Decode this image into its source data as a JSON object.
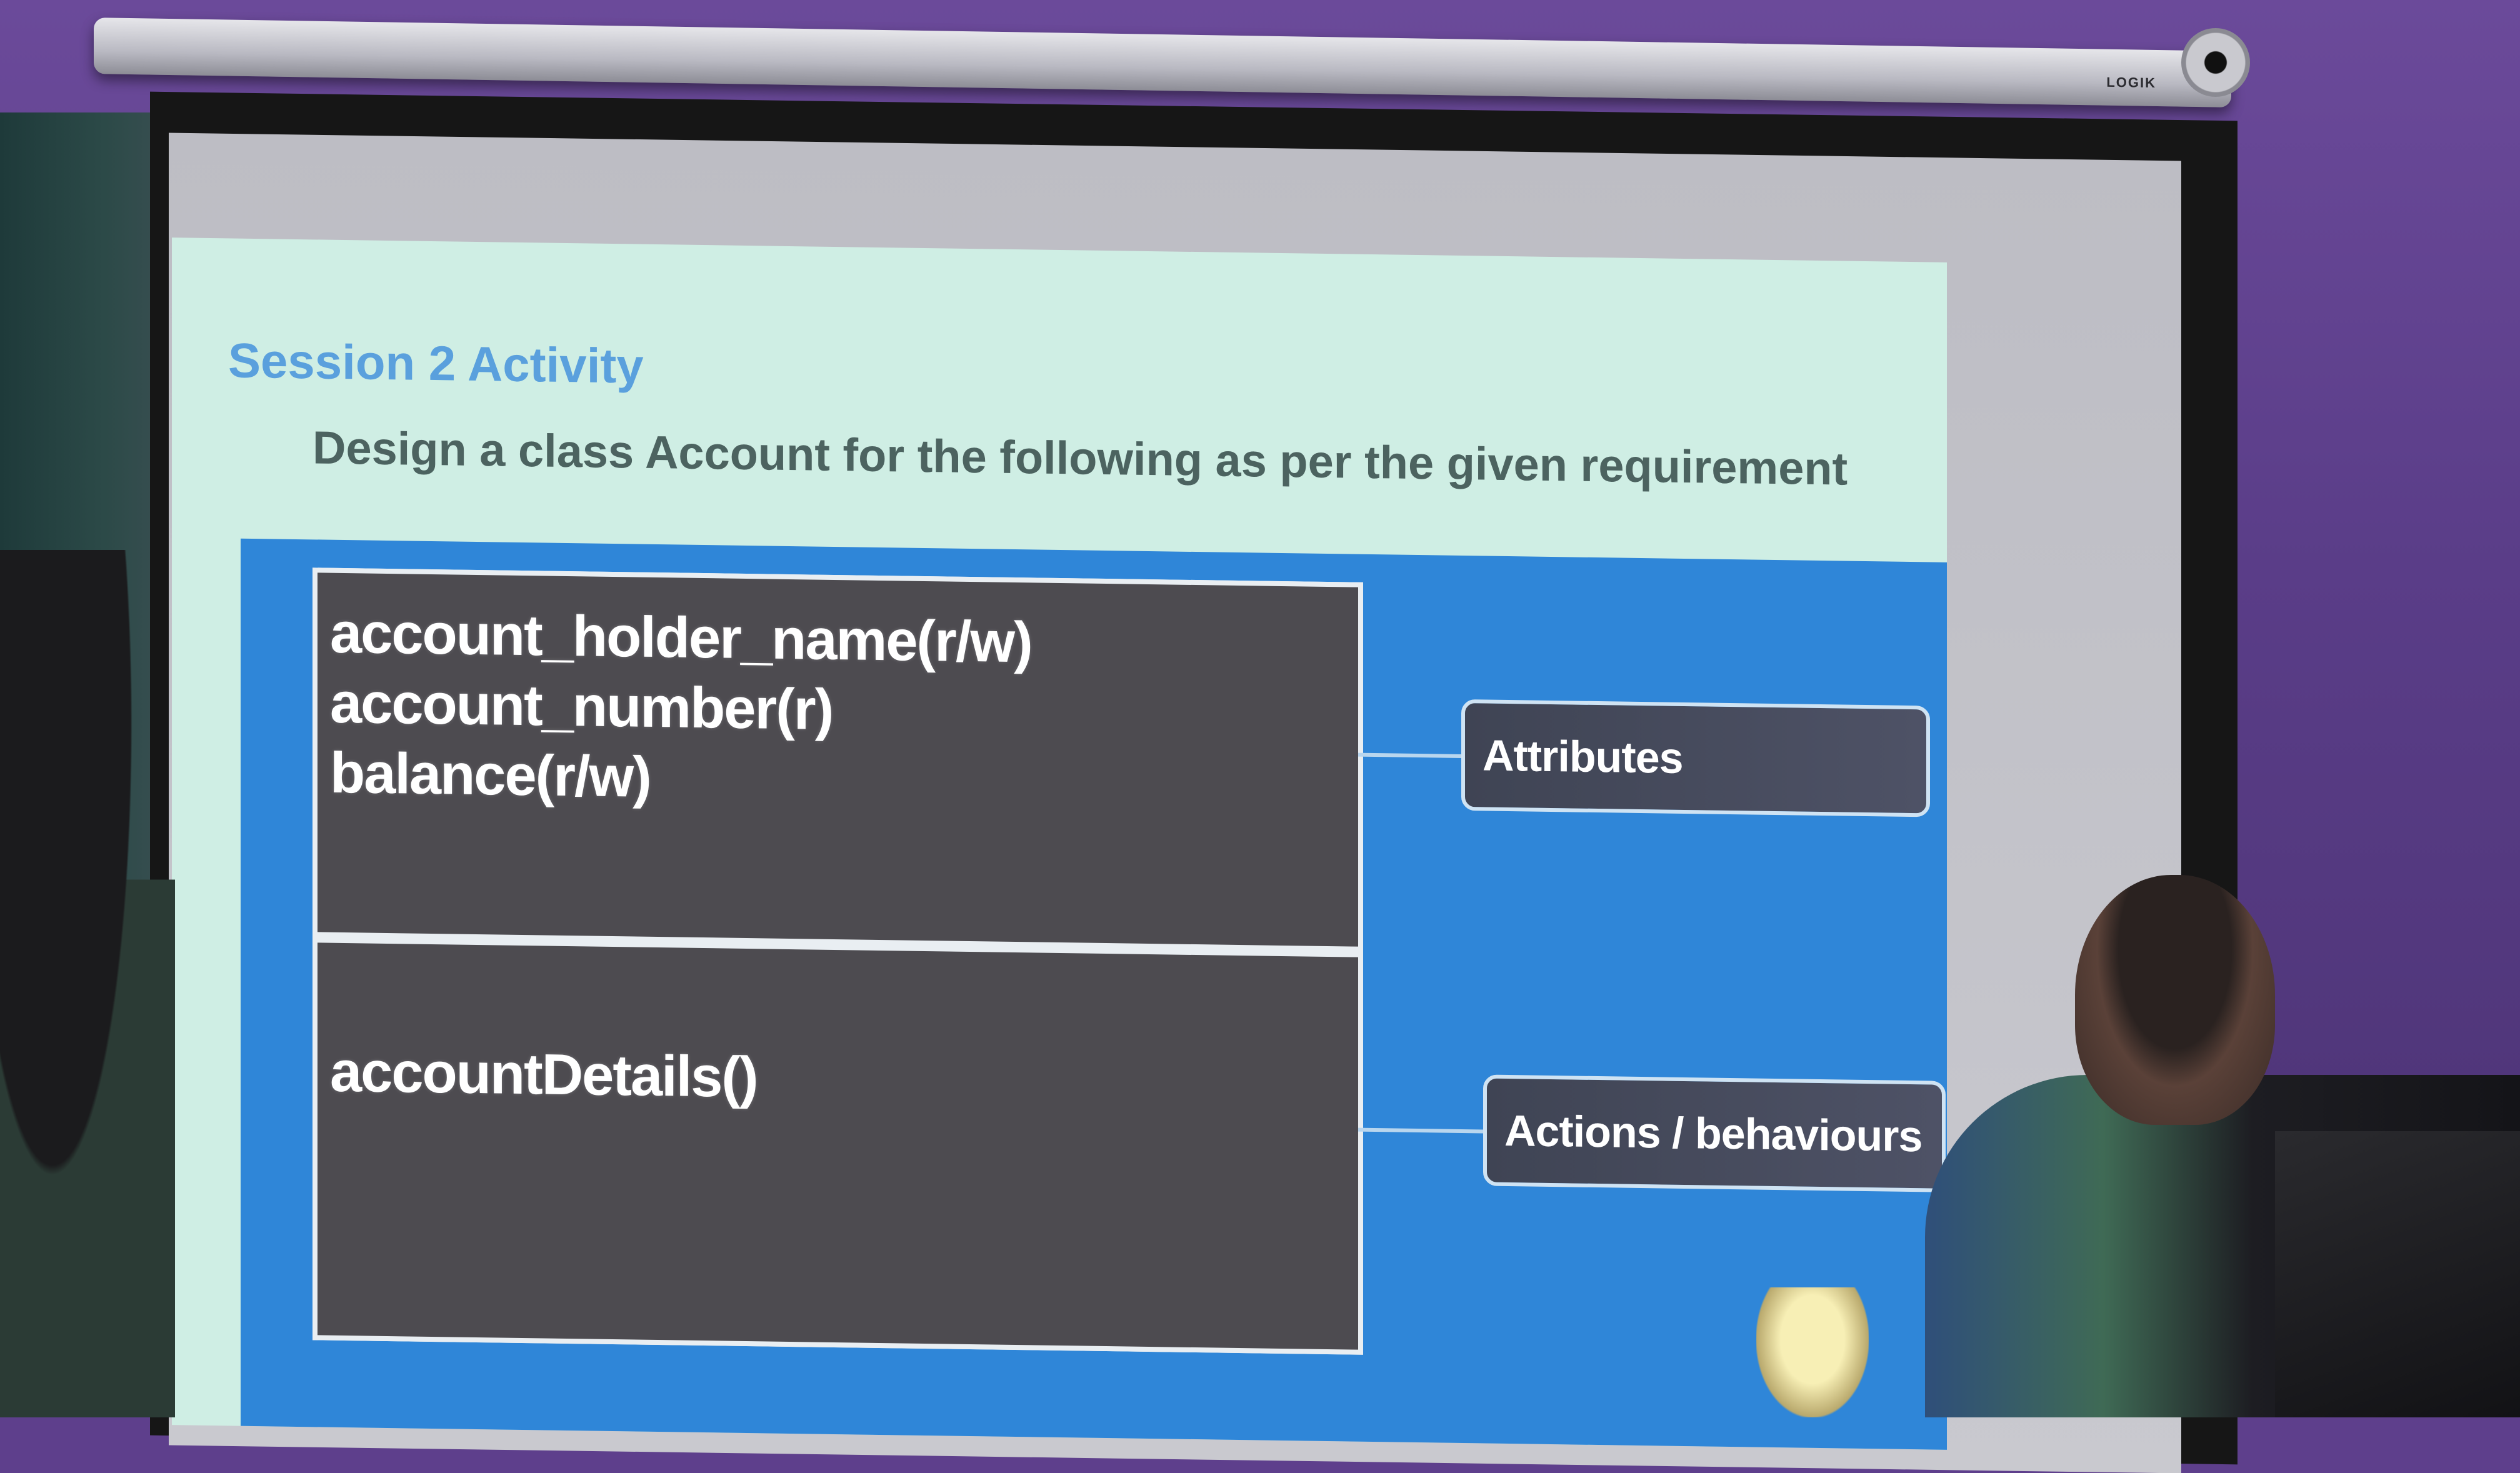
{
  "slide": {
    "title": "Session 2 Activity",
    "subtitle": "Design a class Account for the following as per the given requirement"
  },
  "class_diagram": {
    "attributes": [
      "account_holder_name(r/w)",
      "account_number(r)",
      "balance(r/w)"
    ],
    "operations": [
      "accountDetails()"
    ],
    "callouts": {
      "attributes_label": "Attributes",
      "actions_label": "Actions / behaviours"
    }
  },
  "colors": {
    "wall": "#5e3f8c",
    "slide_background": "#cfeee4",
    "title_blue": "#5aa0dd",
    "panel_blue": "#2f86d8",
    "class_box_gray": "#4d4b50"
  }
}
